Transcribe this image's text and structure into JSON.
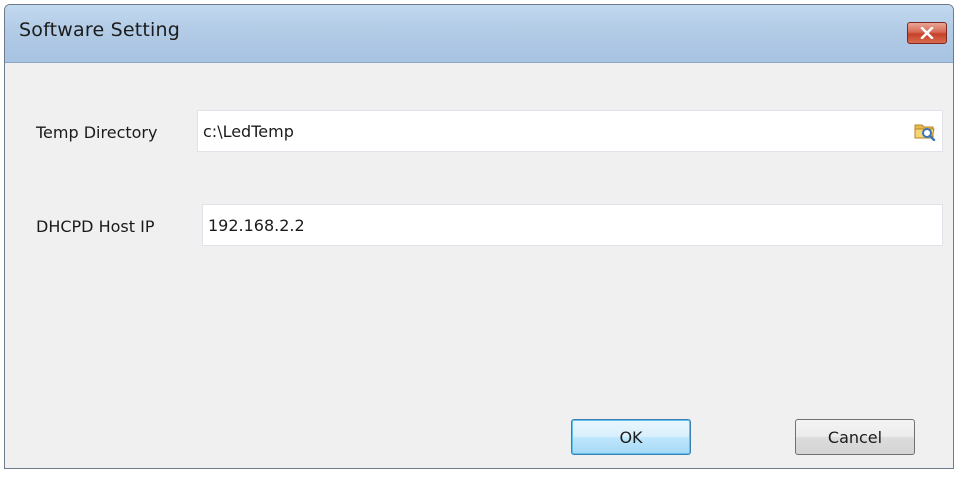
{
  "window": {
    "title": "Software Setting",
    "close_icon": "close-icon"
  },
  "form": {
    "temp_directory": {
      "label": "Temp Directory",
      "value": "c:\\LedTemp",
      "browse_icon": "folder-browse-icon"
    },
    "dhcpd_host_ip": {
      "label": "DHCPD Host IP",
      "value": "192.168.2.2"
    }
  },
  "buttons": {
    "ok": "OK",
    "cancel": "Cancel"
  },
  "colors": {
    "titlebar": "#b2cbe6",
    "close_button": "#c7412a",
    "default_button_border": "#3c7fb1"
  }
}
